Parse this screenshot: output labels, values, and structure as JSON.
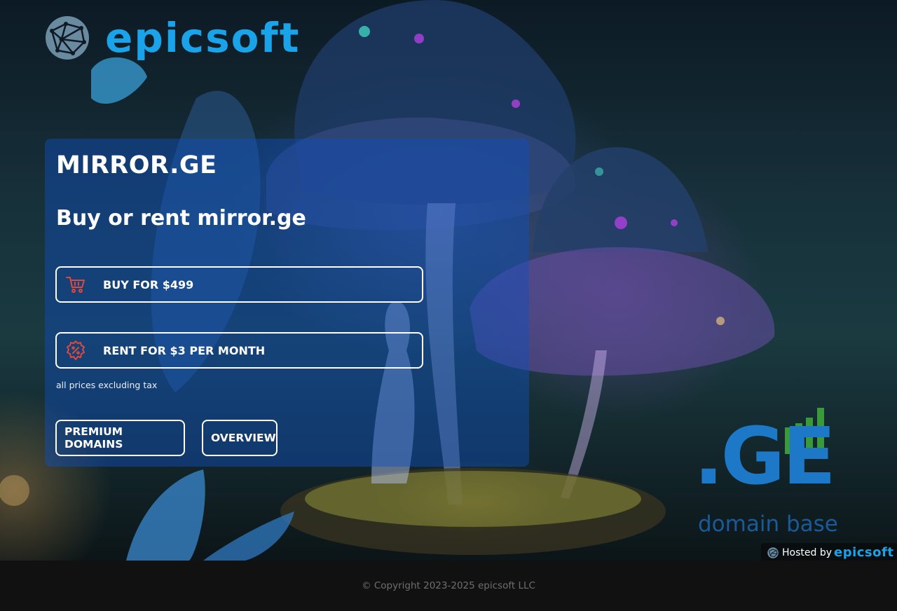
{
  "brand": {
    "logo_icon": "globe-network-icon",
    "name": "epicsoft",
    "color": "#1aa3e8"
  },
  "panel": {
    "domain": "MIRROR.GE",
    "subtitle": "Buy or rent mirror.ge",
    "buy": {
      "icon": "shopping-cart-icon",
      "label": "BUY FOR $499"
    },
    "rent": {
      "icon": "discount-badge-icon",
      "label": "RENT FOR $3 PER MONTH"
    },
    "tax_note": "all prices excluding tax",
    "nav": {
      "premium_label": "PREMIUM DOMAINS",
      "overview_label": "OVERVIEW"
    }
  },
  "ge_logo": {
    "title": ".GE",
    "subtitle": "domain base",
    "bar_color": "#3a9a3a"
  },
  "hosted": {
    "label": "Hosted by",
    "brand": "epicsoft"
  },
  "footer": {
    "copyright": "© Copyright 2023-2025 epicsoft LLC"
  },
  "colors": {
    "panel_bg": "rgba(16,80,190,0.45)",
    "icon_red": "#e0483c",
    "footer_bg": "#111111"
  }
}
